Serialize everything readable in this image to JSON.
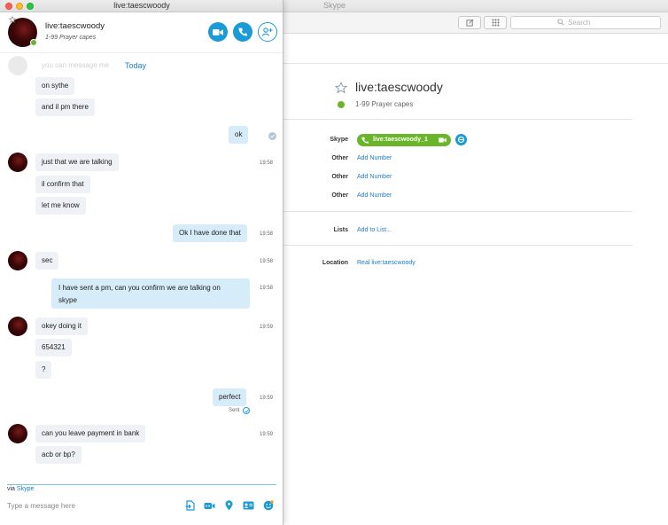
{
  "main_window": {
    "title": "Skype",
    "search_placeholder": "Search",
    "profile": {
      "name": "live:taescwoody",
      "mood": "1-99 Prayer capes",
      "fields": {
        "skype_label": "Skype",
        "skype_value": "live:taescwoody_1",
        "other_label": "Other",
        "add_number": "Add Number",
        "lists_label": "Lists",
        "lists_value": "Add to List...",
        "location_label": "Location",
        "location_value": "Real live:taescwoody"
      }
    }
  },
  "chat_window": {
    "title": "live:taescwoody",
    "header": {
      "name": "live:taescwoody",
      "mood": "1-99 Prayer capes",
      "buttons": [
        "video-call-icon",
        "phone-icon",
        "add-contact-icon"
      ]
    },
    "ghost_message": "you can message me",
    "date_divider": "Today",
    "messages": {
      "m1": {
        "text": "on sythe"
      },
      "m2": {
        "text": "and il pm there"
      },
      "m3": {
        "text": "ok"
      },
      "m4": {
        "text": "just that we are talking",
        "time": "19:58"
      },
      "m5": {
        "text": "il confirm that"
      },
      "m6": {
        "text": "let me know"
      },
      "m7": {
        "text": "Ok I have done that",
        "time": "19:58"
      },
      "m8": {
        "text": "sec",
        "time": "19:58"
      },
      "m9": {
        "line1": "I have sent a pm, can you confirm we are talking on",
        "line2": "skype",
        "time": "19:58"
      },
      "m10": {
        "text": "okey doing it",
        "time": "19:59"
      },
      "m11": {
        "text": "654321"
      },
      "m12": {
        "text": "?"
      },
      "m13": {
        "text": "perfect",
        "time": "19:59",
        "status": "Sent"
      },
      "m14": {
        "text": "can you leave  payment in bank",
        "time": "19:59"
      },
      "m15": {
        "text": "acb or bp?"
      }
    },
    "composer": {
      "via_prefix": "via",
      "via_link": "Skype",
      "placeholder": "Type a message here"
    }
  },
  "colors": {
    "accent": "#1a9bd7",
    "online": "#6bb52b",
    "outgoing_bubble": "#d6ecf8",
    "incoming_bubble": "#eef1f5"
  }
}
